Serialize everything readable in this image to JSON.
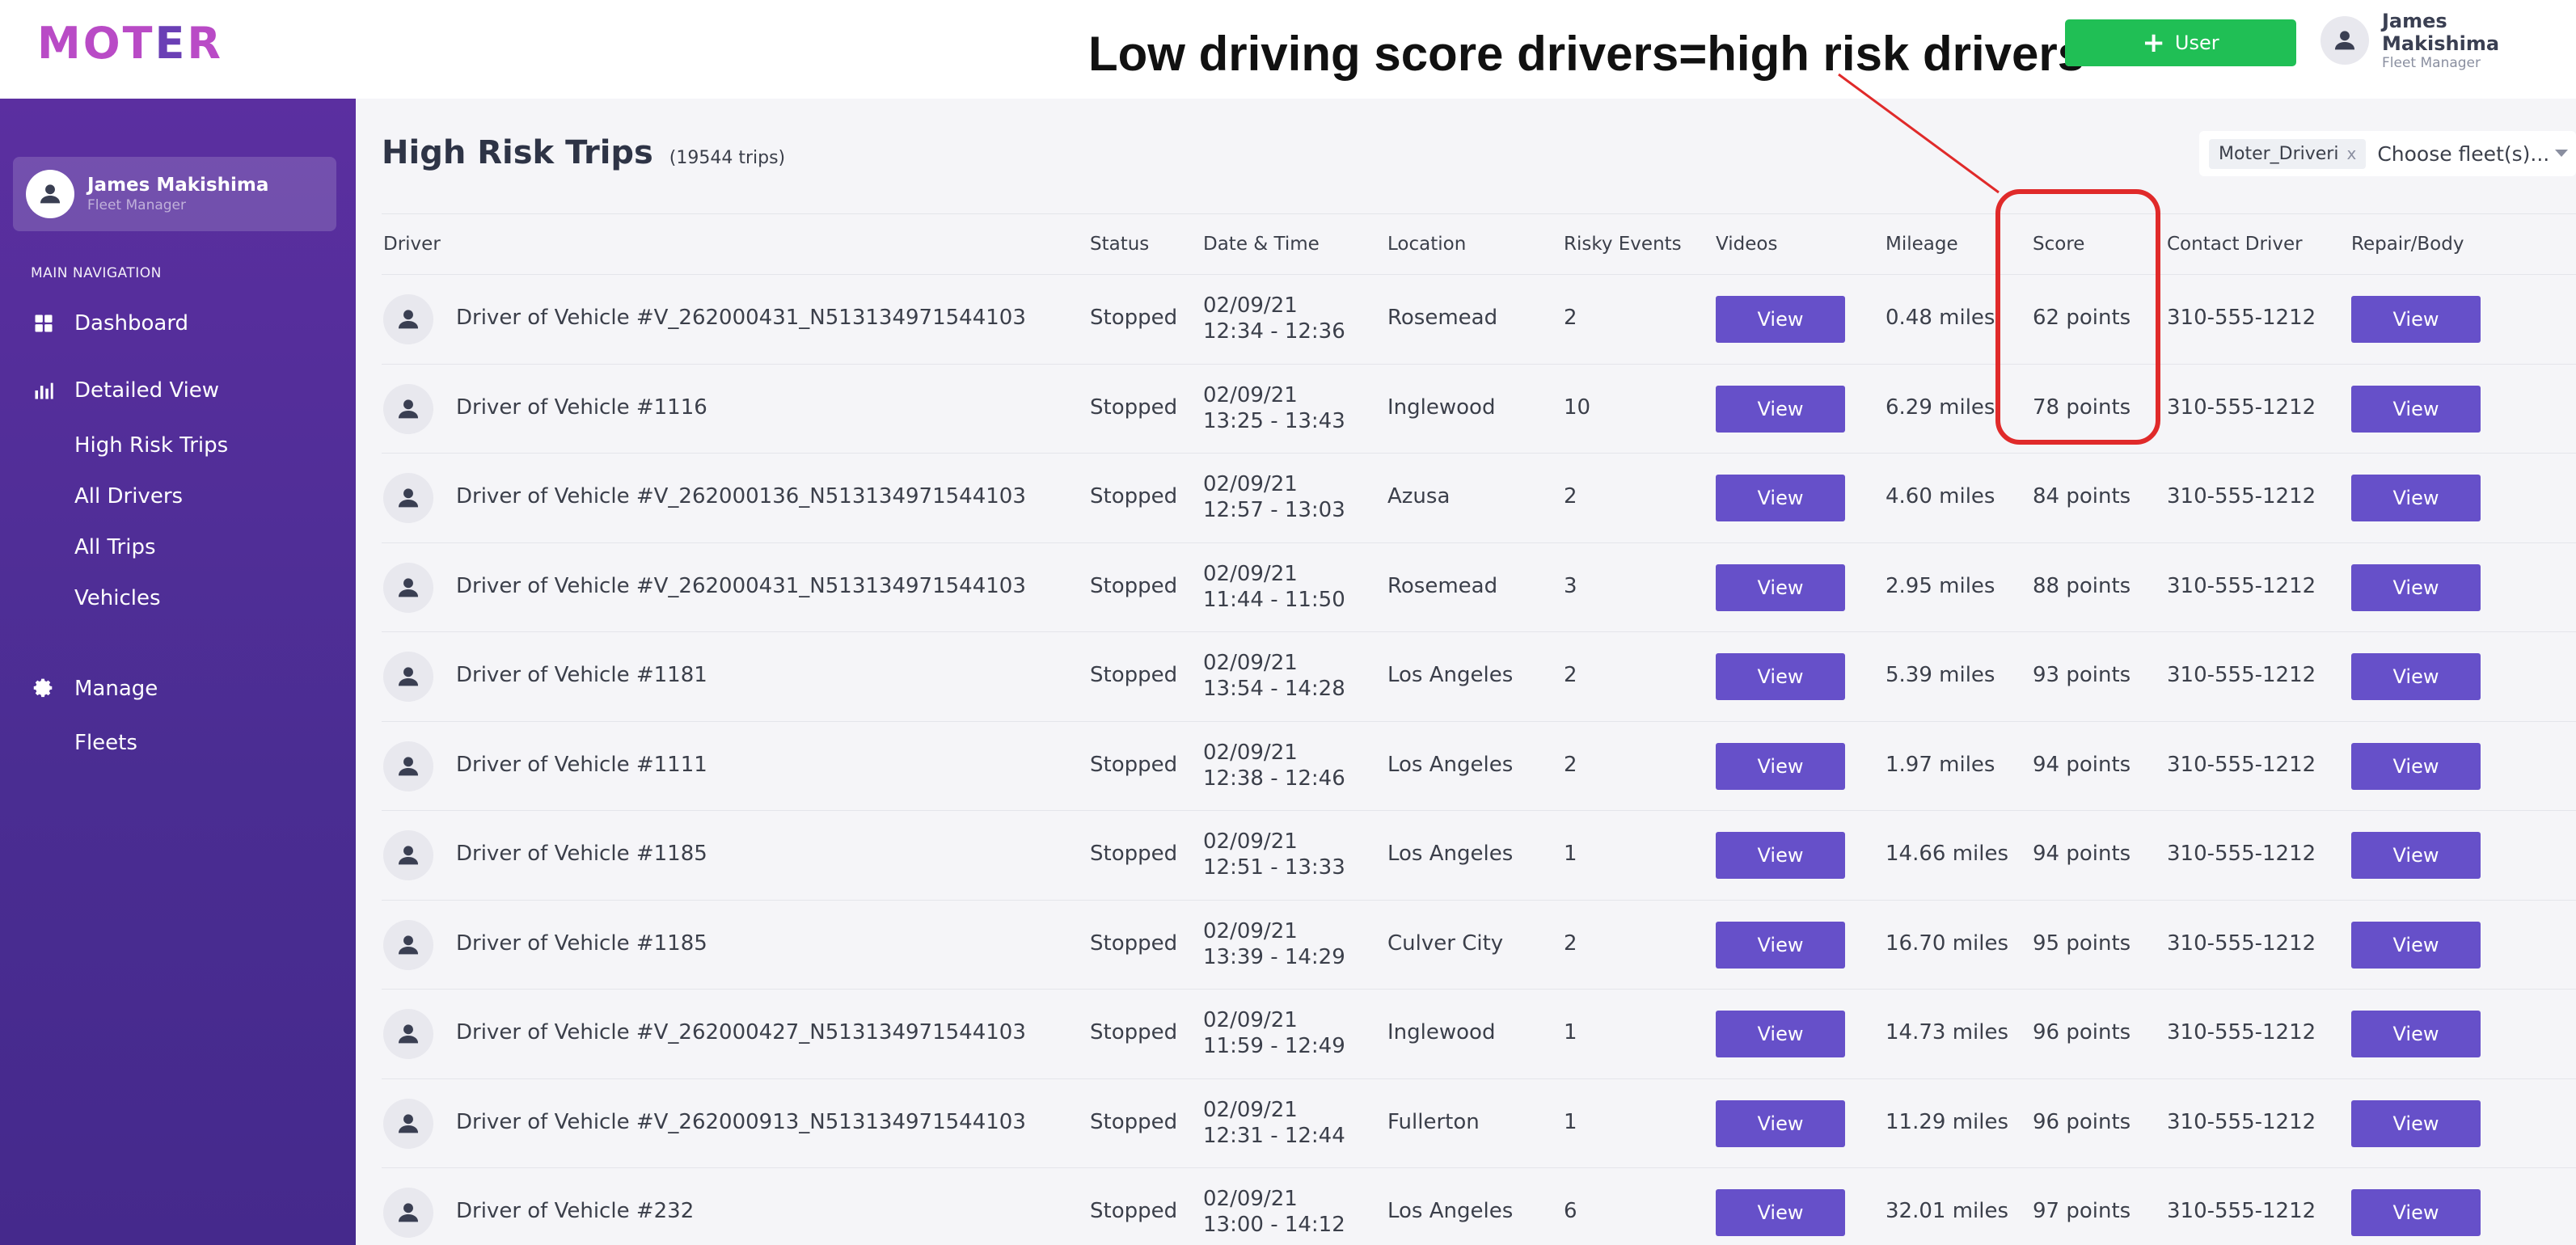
{
  "header": {
    "logo_text": "MOTER",
    "annotation": "Low driving score drivers=high risk drivers",
    "add_user_label": "User",
    "user_name": "James Makishima",
    "user_role": "Fleet Manager"
  },
  "sidebar": {
    "user_name": "James Makishima",
    "user_role": "Fleet Manager",
    "nav_heading": "MAIN NAVIGATION",
    "items": [
      {
        "label": "Dashboard",
        "icon": "grid-icon"
      },
      {
        "label": "Detailed View",
        "icon": "bar-chart-icon"
      },
      {
        "label": "High Risk Trips"
      },
      {
        "label": "All Drivers"
      },
      {
        "label": "All Trips"
      },
      {
        "label": "Vehicles"
      },
      {
        "label": "Manage",
        "icon": "gear-icon"
      },
      {
        "label": "Fleets"
      }
    ]
  },
  "main": {
    "title": "High Risk Trips",
    "count": "(19544 trips)",
    "fleet_chip": "Moter_Driveri",
    "fleet_chip_remove": "x",
    "fleet_placeholder": "Choose fleet(s)..."
  },
  "table": {
    "columns": [
      "Driver",
      "Status",
      "Date & Time",
      "Location",
      "Risky Events",
      "Videos",
      "Mileage",
      "Score",
      "Contact Driver",
      "Repair/Body"
    ],
    "view_label": "View",
    "rows": [
      {
        "driver": "Driver of Vehicle #V_262000431_N513134971544103",
        "status": "Stopped",
        "date": "02/09/21",
        "time": "12:34 - 12:36",
        "location": "Rosemead",
        "risky": "2",
        "mileage": "0.48 miles",
        "score": "62 points",
        "phone": "310-555-1212"
      },
      {
        "driver": "Driver of Vehicle #1116",
        "status": "Stopped",
        "date": "02/09/21",
        "time": "13:25 - 13:43",
        "location": "Inglewood",
        "risky": "10",
        "mileage": "6.29 miles",
        "score": "78 points",
        "phone": "310-555-1212"
      },
      {
        "driver": "Driver of Vehicle #V_262000136_N513134971544103",
        "status": "Stopped",
        "date": "02/09/21",
        "time": "12:57 - 13:03",
        "location": "Azusa",
        "risky": "2",
        "mileage": "4.60 miles",
        "score": "84 points",
        "phone": "310-555-1212"
      },
      {
        "driver": "Driver of Vehicle #V_262000431_N513134971544103",
        "status": "Stopped",
        "date": "02/09/21",
        "time": "11:44 - 11:50",
        "location": "Rosemead",
        "risky": "3",
        "mileage": "2.95 miles",
        "score": "88 points",
        "phone": "310-555-1212"
      },
      {
        "driver": "Driver of Vehicle #1181",
        "status": "Stopped",
        "date": "02/09/21",
        "time": "13:54 - 14:28",
        "location": "Los Angeles",
        "risky": "2",
        "mileage": "5.39 miles",
        "score": "93 points",
        "phone": "310-555-1212"
      },
      {
        "driver": "Driver of Vehicle #1111",
        "status": "Stopped",
        "date": "02/09/21",
        "time": "12:38 - 12:46",
        "location": "Los Angeles",
        "risky": "2",
        "mileage": "1.97 miles",
        "score": "94 points",
        "phone": "310-555-1212"
      },
      {
        "driver": "Driver of Vehicle #1185",
        "status": "Stopped",
        "date": "02/09/21",
        "time": "12:51 - 13:33",
        "location": "Los Angeles",
        "risky": "1",
        "mileage": "14.66 miles",
        "score": "94 points",
        "phone": "310-555-1212"
      },
      {
        "driver": "Driver of Vehicle #1185",
        "status": "Stopped",
        "date": "02/09/21",
        "time": "13:39 - 14:29",
        "location": "Culver City",
        "risky": "2",
        "mileage": "16.70 miles",
        "score": "95 points",
        "phone": "310-555-1212"
      },
      {
        "driver": "Driver of Vehicle #V_262000427_N513134971544103",
        "status": "Stopped",
        "date": "02/09/21",
        "time": "11:59 - 12:49",
        "location": "Inglewood",
        "risky": "1",
        "mileage": "14.73 miles",
        "score": "96 points",
        "phone": "310-555-1212"
      },
      {
        "driver": "Driver of Vehicle #V_262000913_N513134971544103",
        "status": "Stopped",
        "date": "02/09/21",
        "time": "12:31 - 12:44",
        "location": "Fullerton",
        "risky": "1",
        "mileage": "11.29 miles",
        "score": "96 points",
        "phone": "310-555-1212"
      },
      {
        "driver": "Driver of Vehicle #232",
        "status": "Stopped",
        "date": "02/09/21",
        "time": "13:00 - 14:12",
        "location": "Los Angeles",
        "risky": "6",
        "mileage": "32.01 miles",
        "score": "97 points",
        "phone": "310-555-1212"
      }
    ]
  },
  "colors": {
    "brand_pink": "#b94bc6",
    "sidebar": "#4a2d92",
    "primary_button": "#6650c9",
    "add_button": "#20bf55",
    "highlight": "#e02a2a"
  }
}
